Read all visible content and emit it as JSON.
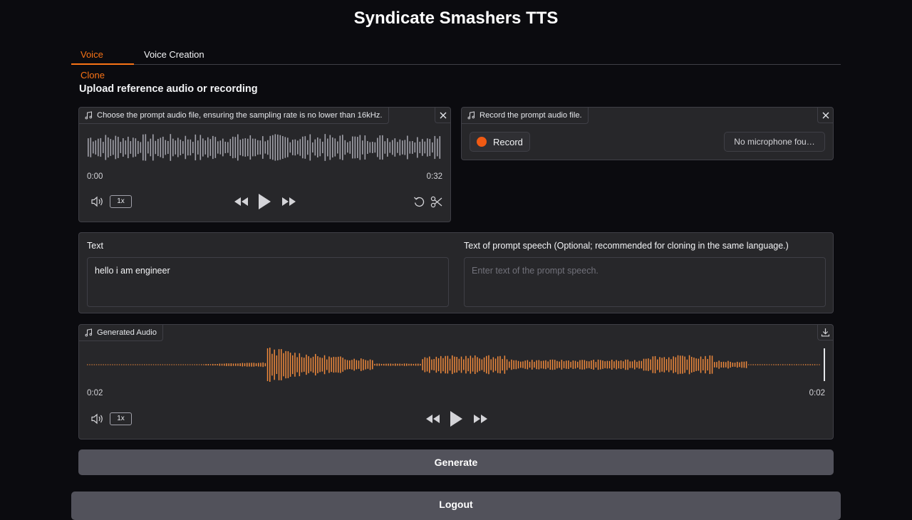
{
  "app": {
    "title": "Syndicate Smashers TTS"
  },
  "tabs": [
    {
      "label": "Voice Clone",
      "active": true
    },
    {
      "label": "Voice Creation",
      "active": false
    }
  ],
  "section_heading": "Upload reference audio or recording",
  "prompt_audio": {
    "label": "Choose the prompt audio file, ensuring the sampling rate is no lower than 16kHz.",
    "time_start": "0:00",
    "time_end": "0:32",
    "rate": "1x"
  },
  "recorder": {
    "label": "Record the prompt audio file.",
    "record_label": "Record",
    "mic_status": "No microphone fou…"
  },
  "text_input": {
    "label": "Text",
    "value": "hello i am engineer"
  },
  "prompt_text": {
    "label": "Text of prompt speech (Optional; recommended for cloning in the same language.)",
    "placeholder": "Enter text of the prompt speech."
  },
  "generated_audio": {
    "label": "Generated Audio",
    "time_start": "0:02",
    "time_end": "0:02",
    "rate": "1x"
  },
  "buttons": {
    "generate": "Generate",
    "logout": "Logout"
  },
  "colors": {
    "accent": "#f97316",
    "waveform_gray": "#a1a1aa",
    "waveform_orange": "#f08a3c"
  }
}
